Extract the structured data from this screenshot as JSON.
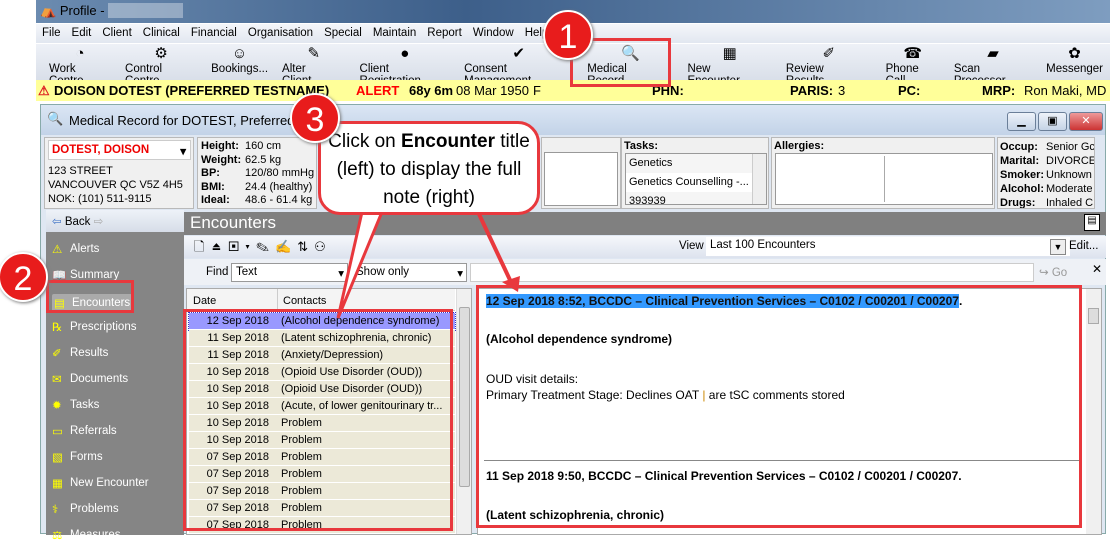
{
  "app": {
    "title": "Profile -"
  },
  "menu": [
    "File",
    "Edit",
    "Client",
    "Clinical",
    "Financial",
    "Organisation",
    "Special",
    "Maintain",
    "Report",
    "Window",
    "Help"
  ],
  "toolbar": [
    {
      "label": "Work Centre",
      "icon": "work-centre-icon",
      "glyph": "◔"
    },
    {
      "label": "Control Centre",
      "icon": "control-centre-icon",
      "glyph": "⚙"
    },
    {
      "label": "Bookings...",
      "icon": "bookings-icon",
      "glyph": "☺"
    },
    {
      "label": "Alter Client...",
      "icon": "alter-client-icon",
      "glyph": "✎"
    },
    {
      "label": "Client Registration",
      "icon": "client-registration-icon",
      "glyph": "●"
    },
    {
      "label": "Consent Management",
      "icon": "consent-icon",
      "glyph": "✔"
    },
    {
      "label": "Medical Record...",
      "icon": "medical-record-icon",
      "glyph": "🔍"
    },
    {
      "label": "New Encounter...",
      "icon": "new-encounter-icon",
      "glyph": "▦"
    },
    {
      "label": "Review Results...",
      "icon": "review-results-icon",
      "glyph": "✐"
    },
    {
      "label": "Phone Call",
      "icon": "phone-icon",
      "glyph": "☎"
    },
    {
      "label": "Scan Processor",
      "icon": "scanner-icon",
      "glyph": "▰"
    },
    {
      "label": "Messenger",
      "icon": "messenger-icon",
      "glyph": "✿"
    }
  ],
  "patient_bar": {
    "name": "DOISON DOTEST (PREFERRED TESTNAME)",
    "alert": "ALERT",
    "age": "68y 6m",
    "dob": "08 Mar 1950",
    "sex": "F",
    "phn_label": "PHN:",
    "paris_label": "PARIS:",
    "paris": "3",
    "pc_label": "PC:",
    "mrp_label": "MRP:",
    "mrp": "Ron Maki, MD"
  },
  "window": {
    "title": "Medical Record for DOTEST, Preferred Tes"
  },
  "patient": {
    "name": "DOTEST, DOISON",
    "address1": "123 STREET",
    "address2": "VANCOUVER  QC  V5Z 4H5",
    "nok": "NOK: (101) 511-9115"
  },
  "vitals": [
    {
      "k": "Height:",
      "v": "160 cm"
    },
    {
      "k": "Weight:",
      "v": "62.5 kg"
    },
    {
      "k": "BP:",
      "v": "120/80 mmHg"
    },
    {
      "k": "BMI:",
      "v": "24.4 (healthy)"
    },
    {
      "k": "Ideal:",
      "v": "48.6 - 61.4 kg"
    }
  ],
  "tasks": {
    "label": "Tasks:",
    "items": [
      "Genetics",
      "Genetics Counselling -...",
      "393939"
    ]
  },
  "allergies": {
    "label": "Allergies:"
  },
  "social": [
    {
      "k": "Occup:",
      "v": "Senior Gc"
    },
    {
      "k": "Marital:",
      "v": "DIVORCE"
    },
    {
      "k": "Smoker:",
      "v": "Unknown"
    },
    {
      "k": "Alcohol:",
      "v": "Moderate"
    },
    {
      "k": "Drugs:",
      "v": "Inhaled C"
    }
  ],
  "nav": {
    "back": "Back",
    "items": [
      {
        "label": "Alerts",
        "icon": "alert-icon",
        "glyph": "⚠"
      },
      {
        "label": "Summary",
        "icon": "summary-icon",
        "glyph": "📖"
      },
      {
        "label": "Encounters",
        "icon": "encounters-icon",
        "glyph": "▤"
      },
      {
        "label": "Prescriptions",
        "icon": "prescriptions-icon",
        "glyph": "℞"
      },
      {
        "label": "Results",
        "icon": "results-icon",
        "glyph": "✐"
      },
      {
        "label": "Documents",
        "icon": "documents-icon",
        "glyph": "✉"
      },
      {
        "label": "Tasks",
        "icon": "tasks-icon",
        "glyph": "✹"
      },
      {
        "label": "Referrals",
        "icon": "referrals-icon",
        "glyph": "▭"
      },
      {
        "label": "Forms",
        "icon": "forms-icon",
        "glyph": "▧"
      },
      {
        "label": "New Encounter",
        "icon": "new-encounter-icon",
        "glyph": "▦"
      },
      {
        "label": "Problems",
        "icon": "problems-icon",
        "glyph": "⚕"
      },
      {
        "label": "Measures",
        "icon": "measures-icon",
        "glyph": "⚖"
      }
    ]
  },
  "encounters": {
    "title": "Encounters",
    "view_label": "View",
    "view_value": "Last 100 Encounters",
    "edit": "Edit...",
    "find_label": "Find",
    "find_type": "Text",
    "show": "Show only",
    "go": "Go",
    "columns": [
      "Date",
      "Contacts"
    ],
    "rows": [
      {
        "date": "12 Sep 2018",
        "contact": "(Alcohol dependence syndrome)"
      },
      {
        "date": "11 Sep 2018",
        "contact": "(Latent schizophrenia, chronic)"
      },
      {
        "date": "11 Sep 2018",
        "contact": "(Anxiety/Depression)"
      },
      {
        "date": "10 Sep 2018",
        "contact": "(Opioid Use Disorder (OUD))"
      },
      {
        "date": "10 Sep 2018",
        "contact": "(Opioid Use Disorder (OUD))"
      },
      {
        "date": "10 Sep 2018",
        "contact": "(Acute, of lower genitourinary tr..."
      },
      {
        "date": "10 Sep 2018",
        "contact": "Problem"
      },
      {
        "date": "10 Sep 2018",
        "contact": "Problem"
      },
      {
        "date": "07 Sep 2018",
        "contact": "Problem"
      },
      {
        "date": "07 Sep 2018",
        "contact": "Problem"
      },
      {
        "date": "07 Sep 2018",
        "contact": "Problem"
      },
      {
        "date": "07 Sep 2018",
        "contact": "Problem"
      },
      {
        "date": "07 Sep 2018",
        "contact": "Problem"
      }
    ]
  },
  "note": {
    "header1": "12 Sep 2018 8:52, BCCDC – Clinical Prevention Services – C0102 / C00201 / C00207",
    "header1_end": ".",
    "problem1": "(Alcohol dependence syndrome)",
    "details_label": "OUD visit details:",
    "details_a": "Primary Treatment Stage: Declines OAT ",
    "details_sep": "|",
    "details_b": " are tSC comments stored",
    "header2": "11 Sep 2018 9:50, BCCDC – Clinical Prevention Services – C0102 / C00201 / C00207.",
    "problem2": "(Latent schizophrenia, chronic)"
  },
  "callouts": {
    "n1": "1",
    "n2": "2",
    "n3": "3",
    "bubble_a": "Click on ",
    "bubble_b": "Encounter",
    "bubble_c": " title (left) to display the full note (right)"
  },
  "colors": {
    "accent": "#e8383d",
    "alert": "#ff0000",
    "patient_bar": "#ffff99",
    "selection": "#3399ff"
  }
}
